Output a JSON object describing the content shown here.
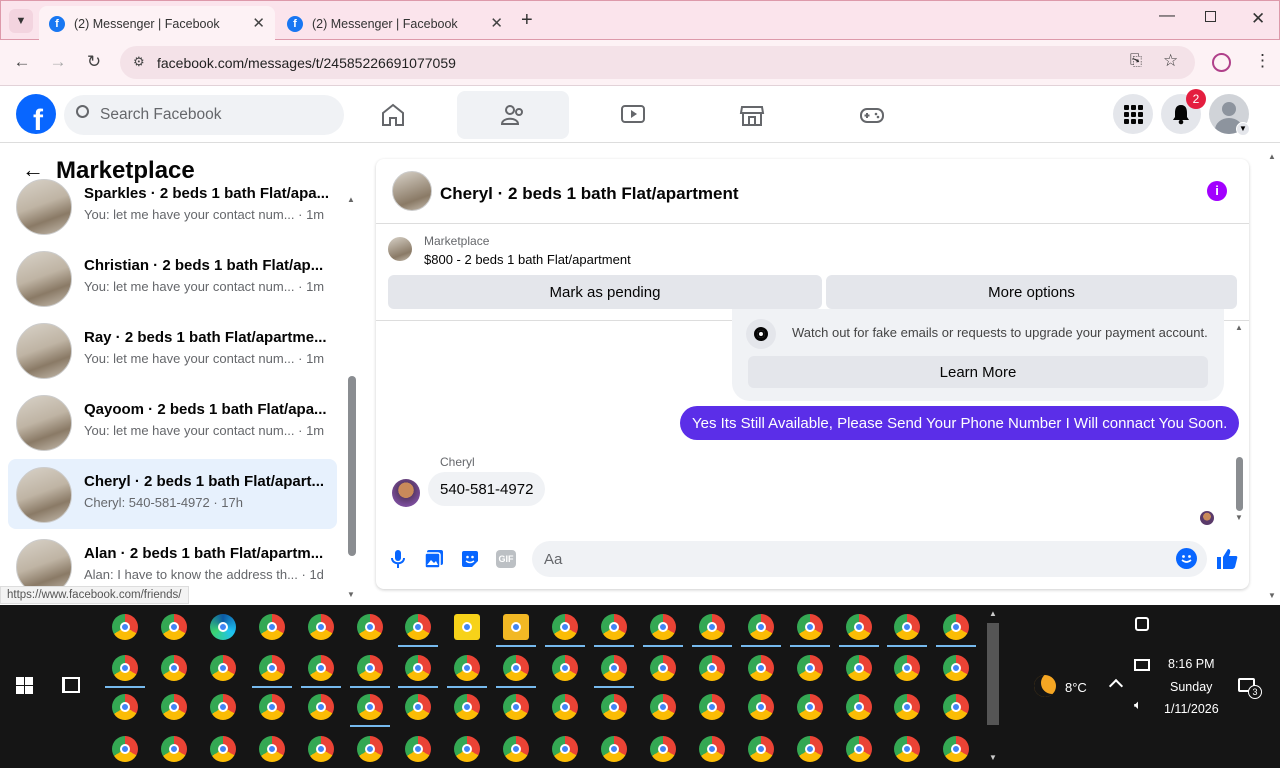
{
  "browser": {
    "tabs": [
      {
        "title": "(2) Messenger | Facebook"
      },
      {
        "title": "(2) Messenger | Facebook"
      }
    ],
    "url": "facebook.com/messages/t/24585226691077059",
    "status_url": "https://www.facebook.com/friends/"
  },
  "fb": {
    "search_placeholder": "Search Facebook",
    "notifications_badge": "2",
    "nav_icons": [
      "home-icon",
      "friends-icon",
      "watch-icon",
      "marketplace-icon",
      "gaming-icon"
    ]
  },
  "sidebar": {
    "title": "Marketplace",
    "conversations": [
      {
        "name": "Sparkles · 2 beds 1 bath Flat/apa...",
        "preview": "You: let me have your contact num... · 1m"
      },
      {
        "name": "Christian · 2 beds 1 bath Flat/ap...",
        "preview": "You: let me have your contact num... · 1m"
      },
      {
        "name": "Ray · 2 beds 1 bath Flat/apartme...",
        "preview": "You: let me have your contact num... · 1m"
      },
      {
        "name": "Qayoom · 2 beds 1 bath Flat/apa...",
        "preview": "You: let me have your contact num... · 1m"
      },
      {
        "name": "Cheryl · 2 beds 1 bath Flat/apart...",
        "preview": "Cheryl: 540-581-4972 · 17h"
      },
      {
        "name": "Alan · 2 beds 1 bath Flat/apartm...",
        "preview": "Alan: I have to know the address th... · 1d"
      }
    ]
  },
  "chat": {
    "title": "Cheryl · 2 beds 1 bath Flat/apartment",
    "listing_label": "Marketplace",
    "listing_title": "$800 - 2 beds 1 bath Flat/apartment",
    "mark_pending": "Mark as pending",
    "more_options": "More options",
    "warning_text": "Watch out for fake emails or requests to upgrade your payment account.",
    "learn_more": "Learn More",
    "sent_message": "Yes Its Still Available, Please Send Your Phone Number I Will connact You Soon.",
    "sender_name": "Cheryl",
    "received_message": "540-581-4972",
    "composer_placeholder": "Aa",
    "accent": "#5b2ee8"
  },
  "taskbar": {
    "weather_temp": "8°C",
    "time": "8:16 PM",
    "day": "Sunday",
    "date": "1/11/2026",
    "notif_count": "3"
  }
}
